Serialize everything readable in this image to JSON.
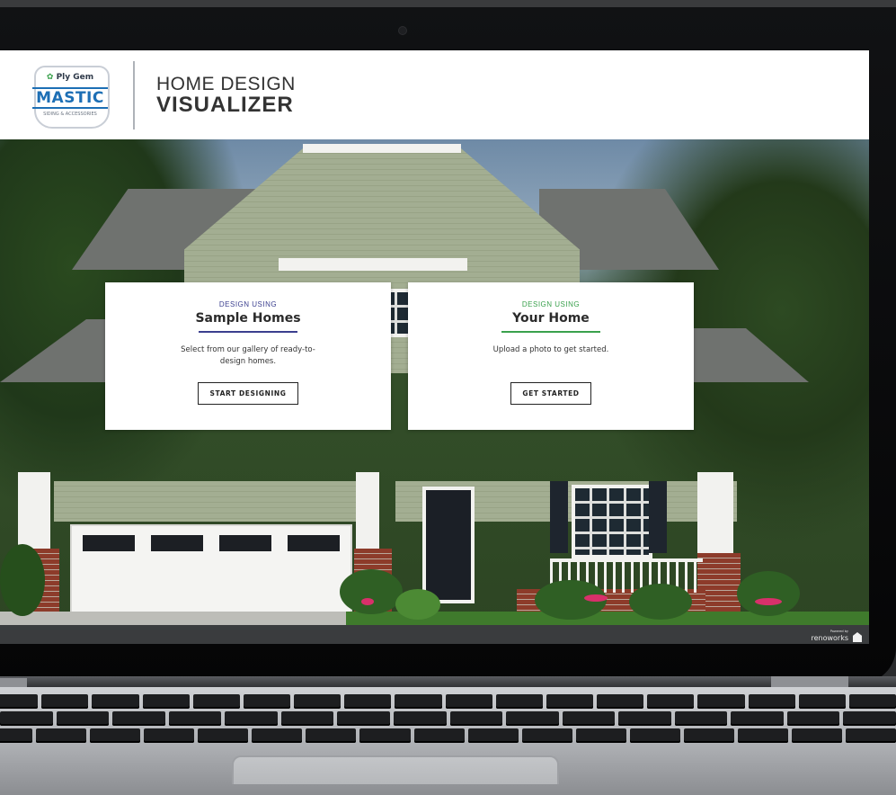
{
  "header": {
    "logo": {
      "brand_top": "Ply Gem",
      "brand_main": "MASTIC",
      "brand_sub": "SIDING & ACCESSORIES"
    },
    "title_line1": "HOME DESIGN",
    "title_line2": "VISUALIZER"
  },
  "cards": [
    {
      "eyebrow": "DESIGN USING",
      "title": "Sample Homes",
      "body": "Select from our gallery of ready-to-design homes.",
      "button": "START DESIGNING",
      "accent": "#3b3f8f"
    },
    {
      "eyebrow": "DESIGN USING",
      "title": "Your Home",
      "body": "Upload a photo to get started.",
      "button": "GET STARTED",
      "accent": "#3aa14d"
    }
  ],
  "footer": {
    "powered_by": "Powered by",
    "brand": "renoworks"
  }
}
